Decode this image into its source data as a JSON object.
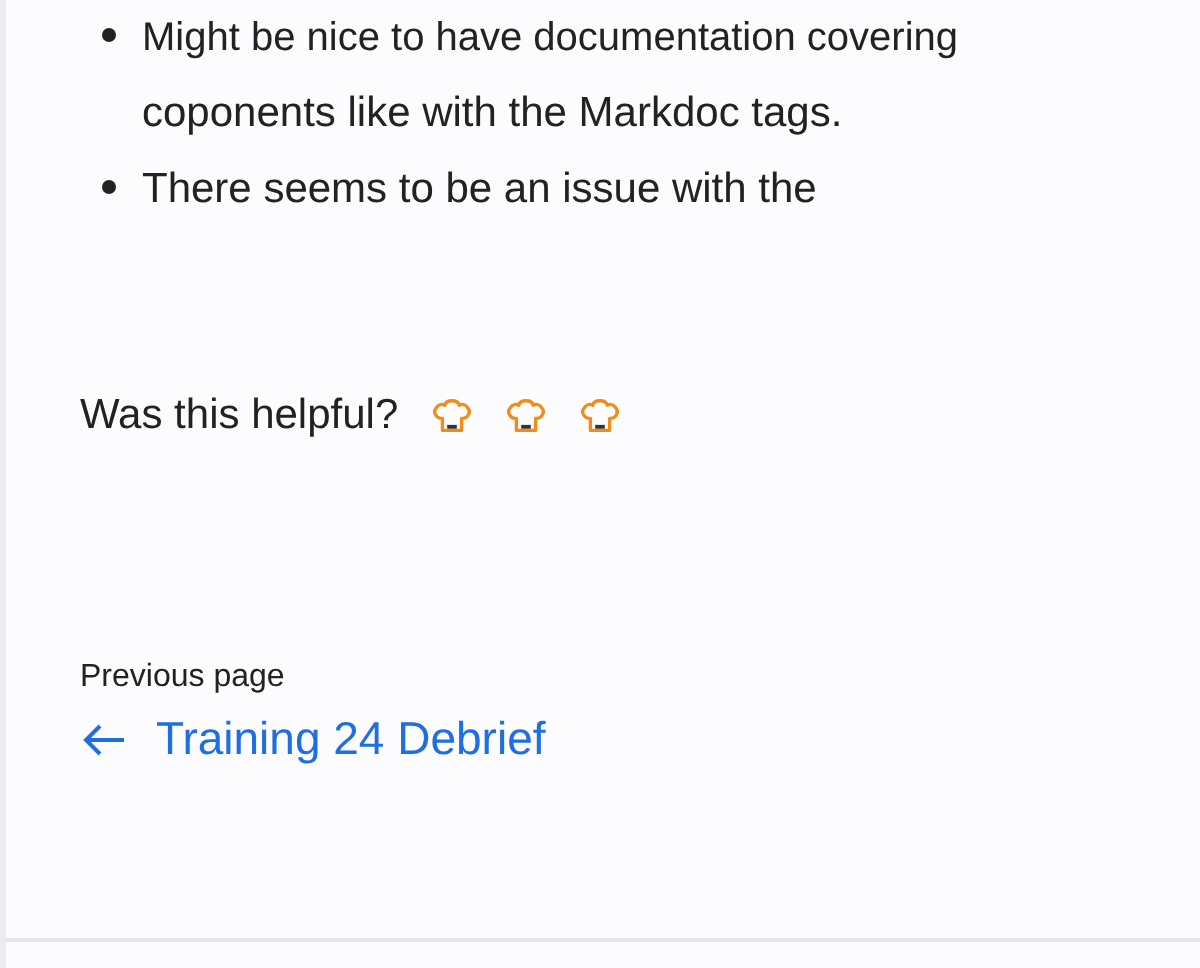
{
  "list": [
    {
      "text": "Might be nice to have documentation covering",
      "cont": "coponents like with the Markdoc tags."
    },
    {
      "text": "There seems to be an issue with the"
    }
  ],
  "feedback": {
    "question": "Was this helpful?",
    "options": [
      {
        "kind": "hat"
      },
      {
        "kind": "hat"
      },
      {
        "kind": "hat"
      }
    ]
  },
  "previous_page": {
    "label": "Previous page",
    "link": "Training 24 Debrief"
  }
}
